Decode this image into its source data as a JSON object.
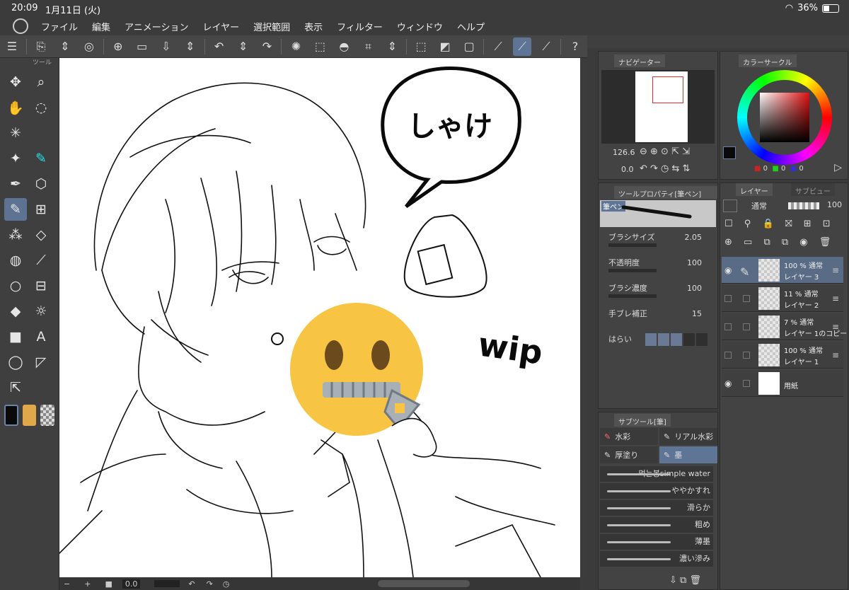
{
  "status": {
    "time": "20:09",
    "date": "1月11日 (火)",
    "battery": "36%"
  },
  "menu": [
    "ファイル",
    "編集",
    "アニメーション",
    "レイヤー",
    "選択範囲",
    "表示",
    "フィルター",
    "ウィンドウ",
    "ヘルプ"
  ],
  "toolbox": {
    "title": "ツール"
  },
  "colors": {
    "main": "#0a0a0a",
    "sub": "#e0a84a",
    "accent": "#5f7595",
    "cyan_tool": "#1fe0e8"
  },
  "canvas_text": {
    "speech": "しゃけ",
    "wip": "wip"
  },
  "statusbottom": {
    "zoom": "0.0"
  },
  "navigator": {
    "title": "ナビゲーター",
    "zoom": "126.6",
    "angle": "0.0"
  },
  "toolprop": {
    "title": "ツールプロパティ[筆ペン]",
    "brush_name": "筆ペン",
    "props": [
      {
        "label": "ブラシサイズ",
        "value": "2.05"
      },
      {
        "label": "不透明度",
        "value": "100"
      },
      {
        "label": "ブラシ濃度",
        "value": "100"
      },
      {
        "label": "手ブレ補正",
        "value": "15"
      }
    ],
    "harai": "はらい"
  },
  "subtool": {
    "title": "サブツール[筆]",
    "items": [
      {
        "label": "水彩"
      },
      {
        "label": "リアル水彩"
      },
      {
        "label": "厚塗り"
      },
      {
        "label": "墨"
      }
    ],
    "brushes": [
      "먹는봉simple water",
      "ややかすれ",
      "滑らか",
      "粗め",
      "薄墨",
      "濃い滲み"
    ]
  },
  "colorcircle": {
    "title": "カラーサークル",
    "r": "0",
    "g": "0",
    "b": "0"
  },
  "layerpanel": {
    "title": "レイヤー",
    "subview": "サブビュー",
    "blend": "通常",
    "opacity": "100",
    "layers": [
      {
        "pct": "100 % 通常",
        "name": "レイヤー 3"
      },
      {
        "pct": "11 % 通常",
        "name": "レイヤー 2"
      },
      {
        "pct": "7 % 通常",
        "name": "レイヤー 1のコピー"
      },
      {
        "pct": "100 % 通常",
        "name": "レイヤー 1"
      },
      {
        "pct": "",
        "name": "用紙"
      }
    ]
  }
}
